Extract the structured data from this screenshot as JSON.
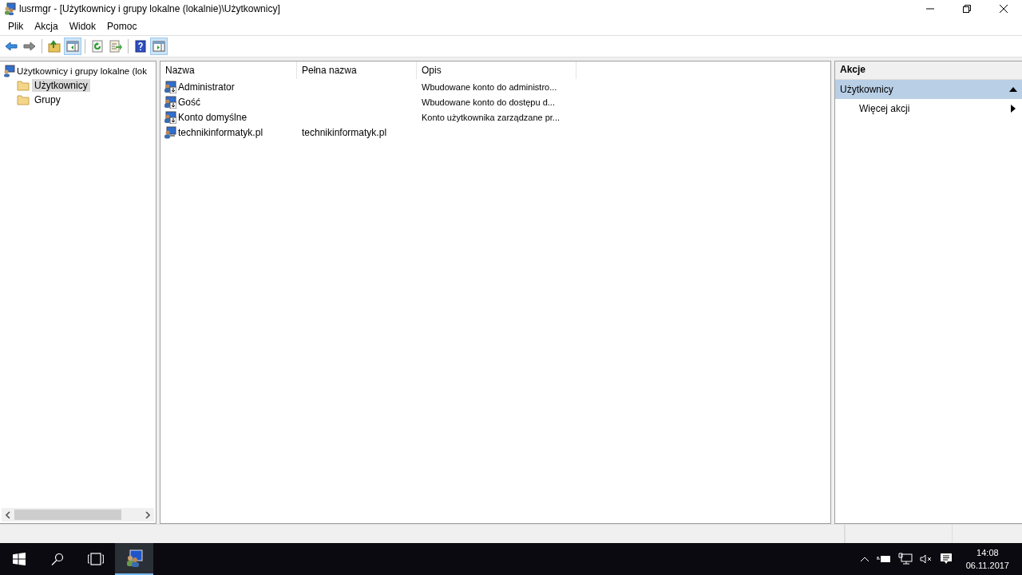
{
  "window": {
    "title": "lusrmgr - [Użytkownicy i grupy lokalne (lokalnie)\\Użytkownicy]"
  },
  "menu": [
    "Plik",
    "Akcja",
    "Widok",
    "Pomoc"
  ],
  "toolbar": [
    [
      {
        "kind": "back",
        "pressed": false
      },
      {
        "kind": "forward",
        "pressed": false
      }
    ],
    [
      {
        "kind": "up",
        "pressed": false
      },
      {
        "kind": "tree",
        "pressed": true
      }
    ],
    [
      {
        "kind": "refresh",
        "pressed": false
      },
      {
        "kind": "export",
        "pressed": false
      }
    ],
    [
      {
        "kind": "help",
        "pressed": false
      },
      {
        "kind": "actionpane",
        "pressed": true
      }
    ]
  ],
  "tree": {
    "label": "Użytkownicy i grupy lokalne (lok",
    "children": [
      {
        "label": "Użytkownicy",
        "selected": true
      },
      {
        "label": "Grupy",
        "selected": false
      }
    ]
  },
  "table": {
    "columns": [
      "Nazwa",
      "Pełna nazwa",
      "Opis"
    ],
    "rows": [
      {
        "kind": "builtin",
        "cells": [
          "Administrator",
          "",
          "Wbudowane konto do administro..."
        ]
      },
      {
        "kind": "builtin",
        "cells": [
          "Gość",
          "",
          "Wbudowane konto do dostępu d..."
        ]
      },
      {
        "kind": "builtin",
        "cells": [
          "Konto domyślne",
          "",
          "Konto użytkownika zarządzane pr..."
        ]
      },
      {
        "kind": "user",
        "cells": [
          "technikinformatyk.pl",
          "technikinformatyk.pl",
          ""
        ]
      }
    ]
  },
  "actions": {
    "title": "Akcje",
    "section": {
      "label": "Użytkownicy",
      "expanded": true
    },
    "items": [
      {
        "label": "Więcej akcji",
        "submenu": true
      }
    ]
  },
  "taskbar": {
    "time": "14:08",
    "date": "06.11.2017"
  }
}
